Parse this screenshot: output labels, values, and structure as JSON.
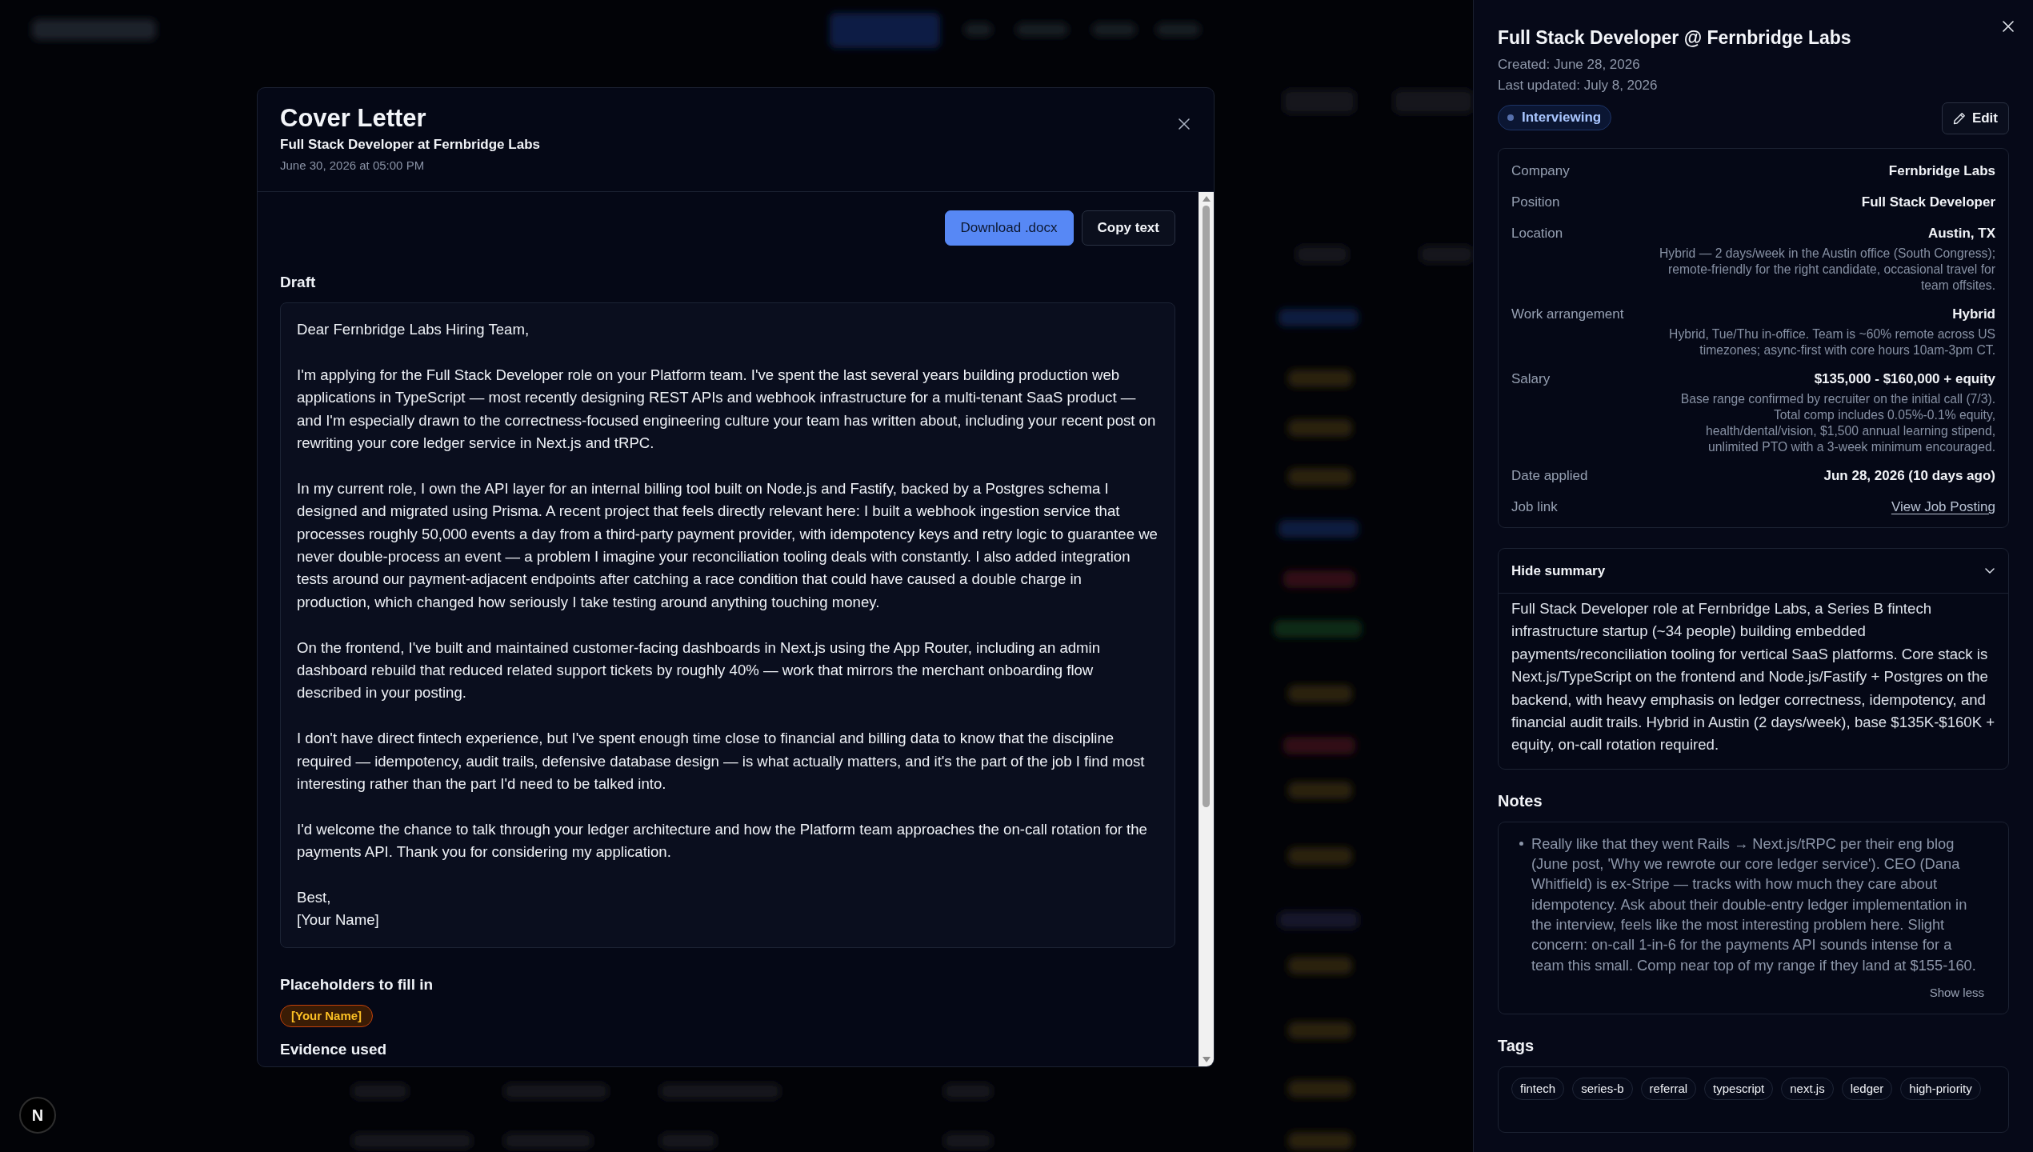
{
  "cover_letter_dialog": {
    "title": "Cover Letter",
    "subtitle": "Full Stack Developer at Fernbridge Labs",
    "timestamp": "June 30, 2026 at 05:00 PM",
    "actions": [
      {
        "label": "Download .docx",
        "kind": "primary"
      },
      {
        "label": "Copy text",
        "kind": "secondary"
      }
    ],
    "draft": {
      "heading": "Draft",
      "paragraphs": [
        "Dear Fernbridge Labs Hiring Team,",
        "I'm applying for the Full Stack Developer role on your Platform team. I've spent the last several years building production web applications in TypeScript — most recently designing REST APIs and webhook infrastructure for a multi-tenant SaaS product — and I'm especially drawn to the correctness-focused engineering culture your team has written about, including your recent post on rewriting your core ledger service in Next.js and tRPC.",
        "In my current role, I own the API layer for an internal billing tool built on Node.js and Fastify, backed by a Postgres schema I designed and migrated using Prisma. A recent project that feels directly relevant here: I built a webhook ingestion service that processes roughly 50,000 events a day from a third-party payment provider, with idempotency keys and retry logic to guarantee we never double-process an event — a problem I imagine your reconciliation tooling deals with constantly. I also added integration tests around our payment-adjacent endpoints after catching a race condition that could have caused a double charge in production, which changed how seriously I take testing around anything touching money.",
        "On the frontend, I've built and maintained customer-facing dashboards in Next.js using the App Router, including an admin dashboard rebuild that reduced related support tickets by roughly 40% — work that mirrors the merchant onboarding flow described in your posting.",
        "I don't have direct fintech experience, but I've spent enough time close to financial and billing data to know that the discipline required — idempotency, audit trails, defensive database design — is what actually matters, and it's the part of the job I find most interesting rather than the part I'd need to be talked into.",
        "I'd welcome the chance to talk through your ledger architecture and how the Platform team approaches the on-call rotation for the payments API. Thank you for considering my application."
      ],
      "sign_off": [
        "Best,",
        "[Your Name]"
      ]
    },
    "placeholders": {
      "heading": "Placeholders to fill in",
      "items": [
        "[Your Name]"
      ]
    },
    "evidence": {
      "heading": "Evidence used"
    }
  },
  "dev_tools_button": {
    "label": "N"
  },
  "job_panel": {
    "title": "Full Stack Developer @ Fernbridge Labs",
    "created": "Created: June 28, 2026",
    "updated": "Last updated: July 8, 2026",
    "status": "Interviewing",
    "edit_button": "Edit",
    "details": [
      {
        "label": "Company",
        "value": "Fernbridge Labs",
        "kind": "text"
      },
      {
        "label": "Position",
        "value": "Full Stack Developer",
        "kind": "text"
      },
      {
        "label": "Location",
        "value": "Austin, TX",
        "kind": "text",
        "note": "Hybrid — 2 days/week in the Austin office (South Congress); remote-friendly for the right candidate, occasional travel for team offsites."
      },
      {
        "label": "Work arrangement",
        "value": "Hybrid",
        "kind": "text",
        "note": "Hybrid, Tue/Thu in-office. Team is ~60% remote across US timezones; async-first with core hours 10am-3pm CT."
      },
      {
        "label": "Salary",
        "value": "$135,000 - $160,000 + equity",
        "kind": "text",
        "note": "Base range confirmed by recruiter on the initial call (7/3). Total comp includes 0.05%-0.1% equity, health/dental/vision, $1,500 annual learning stipend, unlimited PTO with a 3-week minimum encouraged."
      },
      {
        "label": "Date applied",
        "value": "Jun 28, 2026 (10 days ago)",
        "kind": "text"
      },
      {
        "label": "Job link",
        "value": "View Job Posting",
        "kind": "link"
      }
    ],
    "summary": {
      "toggle_label": "Hide summary",
      "expanded": true,
      "text": "Full Stack Developer role at Fernbridge Labs, a Series B fintech infrastructure startup (~34 people) building embedded payments/reconciliation tooling for vertical SaaS platforms. Core stack is Next.js/TypeScript on the frontend and Node.js/Fastify + Postgres on the backend, with heavy emphasis on ledger correctness, idempotency, and financial audit trails. Hybrid in Austin (2 days/week), base $135K-$160K + equity, on-call rotation required."
    },
    "notes": {
      "heading": "Notes",
      "items": [
        "Really like that they went Rails → Next.js/tRPC per their eng blog (June post, 'Why we rewrote our core ledger service'). CEO (Dana Whitfield) is ex-Stripe — tracks with how much they care about idempotency. Ask about their double-entry ledger implementation in the interview, feels like the most interesting problem here. Slight concern: on-call 1-in-6 for the payments API sounds intense for a team this small. Comp near top of my range if they land at $155-160."
      ],
      "toggle_label": "Show less"
    },
    "tags": {
      "heading": "Tags",
      "items": [
        "fintech",
        "series-b",
        "referral",
        "typescript",
        "next.js",
        "ledger",
        "high-priority"
      ]
    }
  }
}
